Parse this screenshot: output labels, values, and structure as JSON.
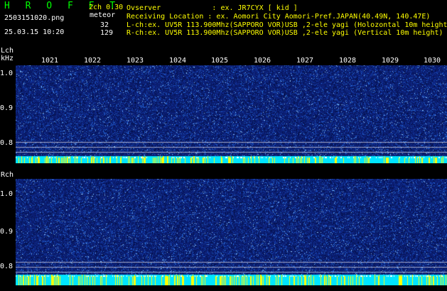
{
  "header": {
    "app_logo": "H R O F F T",
    "filename": "2503151020.png",
    "datetime": "25.03.15 10:20",
    "mode": "2ch 0.30",
    "mode_sub": "meteor",
    "count_l": "32",
    "count_r": "129",
    "observer_line": "Ovserver            : ex. JR7CYX [ kid ]",
    "location_line": "Receiving Location : ex. Aomori City Aomori-Pref.JAPAN(40.49N, 140.47E)",
    "lch_line": "L-ch:ex. UV5R 113.900Mhz(SAPPORO VOR)USB ,2-ele yagi (Holozontal 10m height)",
    "rch_line": "R-ch:ex. UV5R 113.900Mhz(SAPPORO VOR)USB ,2-ele yagi (Vertical 10m height)"
  },
  "axis": {
    "lch_label": "Lch",
    "rch_label": "Rch",
    "unit": "kHz",
    "freq_ticks": [
      "1.0",
      "0.9",
      "0.8"
    ],
    "time_ticks": [
      "1021",
      "1022",
      "1023",
      "1024",
      "1025",
      "1026",
      "1027",
      "1028",
      "1029",
      "1030"
    ]
  },
  "colors": {
    "background": "#000000",
    "spectrum_base": "#0b1e72",
    "noise_bar": "#00e5ff",
    "noise_peak": "#ffff00",
    "logo": "#00ff00"
  }
}
